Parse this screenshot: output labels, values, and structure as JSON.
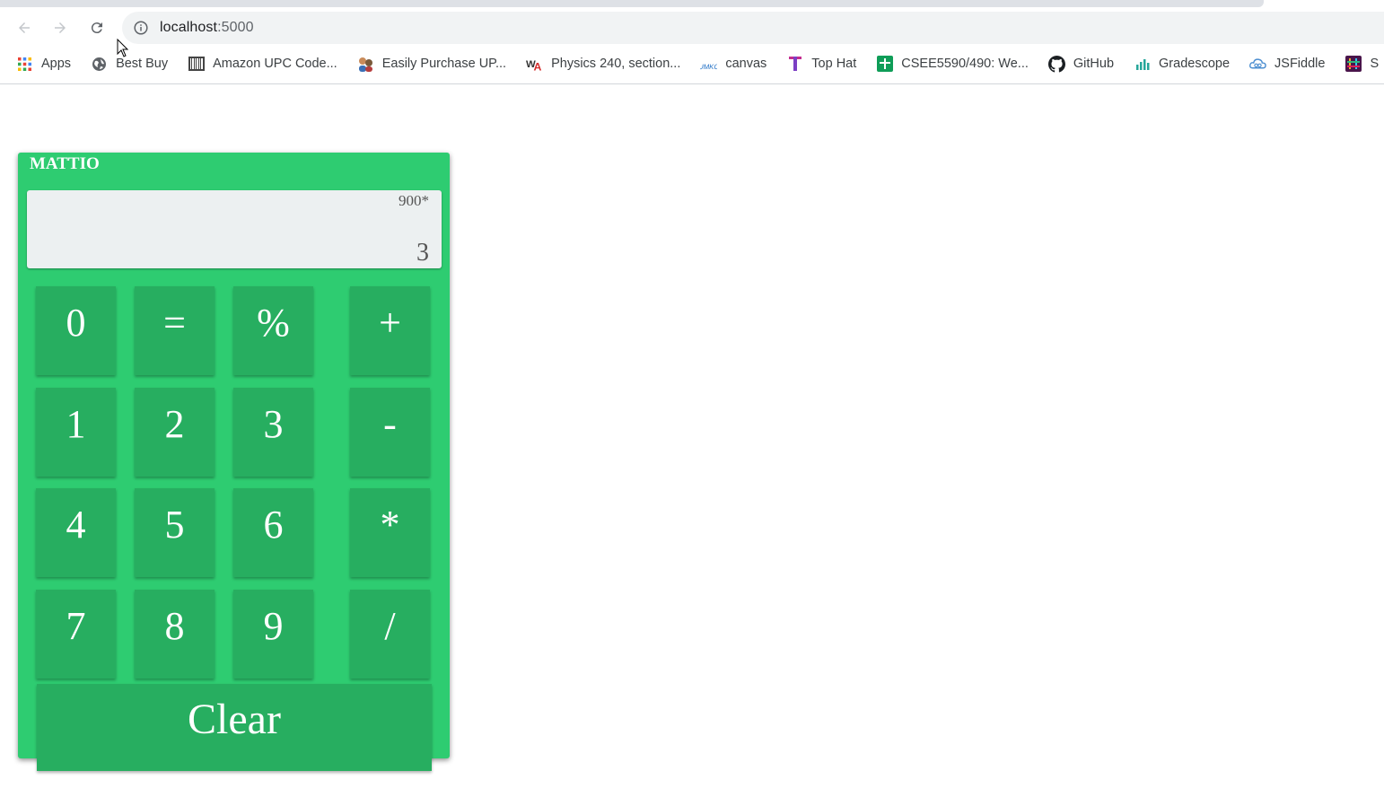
{
  "browser": {
    "url_host": "localhost",
    "url_port": ":5000",
    "bookmarks": [
      {
        "label": "Apps",
        "icon": "apps-grid-icon"
      },
      {
        "label": "Best Buy",
        "icon": "globe-icon"
      },
      {
        "label": "Amazon UPC Code...",
        "icon": "barcode-icon"
      },
      {
        "label": "Easily Purchase UP...",
        "icon": "people-icon"
      },
      {
        "label": "Physics 240, section...",
        "icon": "webassign-icon"
      },
      {
        "label": "canvas",
        "icon": "umkc-icon"
      },
      {
        "label": "Top Hat",
        "icon": "tophat-icon"
      },
      {
        "label": "CSEE5590/490: We...",
        "icon": "sheets-icon"
      },
      {
        "label": "GitHub",
        "icon": "github-icon"
      },
      {
        "label": "Gradescope",
        "icon": "gradescope-icon"
      },
      {
        "label": "JSFiddle",
        "icon": "jsfiddle-icon"
      },
      {
        "label": "S",
        "icon": "slack-icon"
      }
    ]
  },
  "calculator": {
    "title": "MATTIO",
    "expression": "900*",
    "result": "3",
    "keys": {
      "k0": "0",
      "eq": "=",
      "pct": "%",
      "plus": "+",
      "k1": "1",
      "k2": "2",
      "k3": "3",
      "minus": "-",
      "k4": "4",
      "k5": "5",
      "k6": "6",
      "mul": "*",
      "k7": "7",
      "k8": "8",
      "k9": "9",
      "div": "/"
    },
    "clear_label": "Clear",
    "colors": {
      "body": "#2ecc71",
      "button": "#27ae60",
      "display": "#ecf0f1"
    }
  }
}
